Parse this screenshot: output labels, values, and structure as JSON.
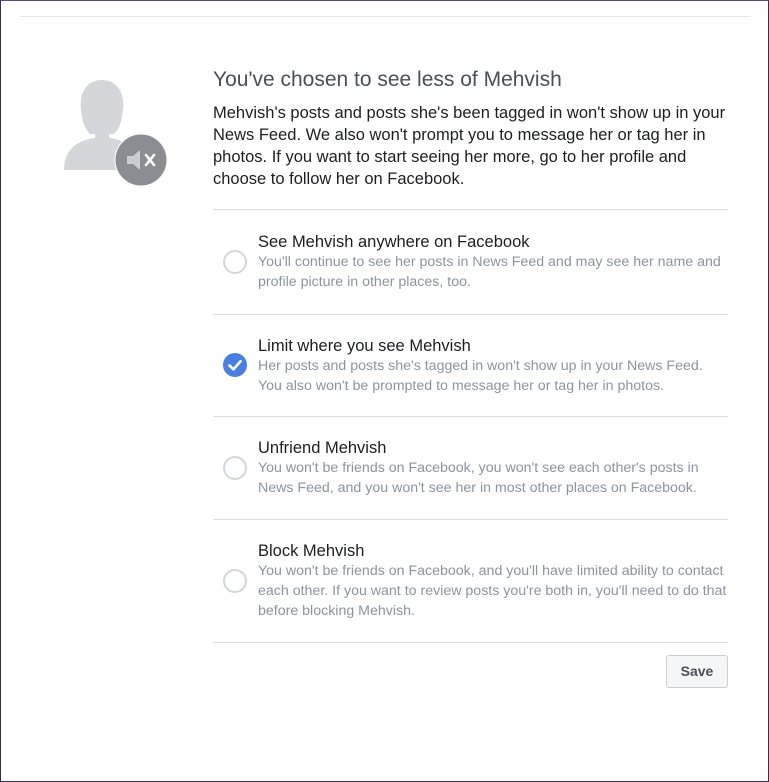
{
  "dialog": {
    "title": "You've chosen to see less of Mehvish",
    "description": "Mehvish's posts and posts she's been tagged in won't show up in your News Feed. We also won't prompt you to message her or tag her in photos. If you want to start seeing her more, go to her profile and choose to follow her on Facebook.",
    "avatar_icon": "person-silhouette-icon",
    "badge_icon": "mute-speaker-icon"
  },
  "options": [
    {
      "title": "See Mehvish anywhere on Facebook",
      "description": "You'll continue to see her posts in News Feed and may see her name and profile picture in other places, too.",
      "selected": false
    },
    {
      "title": "Limit where you see Mehvish",
      "description": "Her posts and posts she's tagged in won't show up in your News Feed. You also won't be prompted to message her or tag her in photos.",
      "selected": true
    },
    {
      "title": "Unfriend Mehvish",
      "description": "You won't be friends on Facebook, you won't see each other's posts in News Feed, and you won't see her in most other places on Facebook.",
      "selected": false
    },
    {
      "title": "Block Mehvish",
      "description": "You won't be friends on Facebook, and you'll have limited ability to contact each other. If you want to review posts you're both in, you'll need to do that before blocking Mehvish.",
      "selected": false
    }
  ],
  "footer": {
    "save_label": "Save"
  },
  "colors": {
    "radio_selected": "#4a7ee0",
    "muted_text": "#8d949e",
    "divider": "#dadde1"
  }
}
